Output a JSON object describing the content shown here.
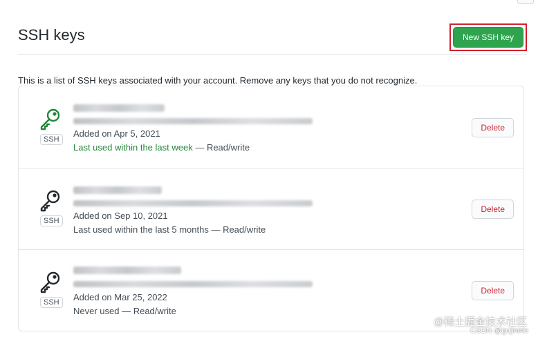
{
  "header": {
    "title": "SSH keys",
    "new_key_label": "New SSH key"
  },
  "intro": "This is a list of SSH keys associated with your account. Remove any keys that you do not recognize.",
  "keys": [
    {
      "badge": "SSH",
      "added": "Added on Apr 5, 2021",
      "last_used": "Last used within the last week",
      "access": " — Read/write",
      "recent": true,
      "delete_label": "Delete",
      "icon": "key-icon",
      "icon_color": "#22863a"
    },
    {
      "badge": "SSH",
      "added": "Added on Sep 10, 2021",
      "last_used": "Last used within the last 5 months",
      "access": " — Read/write",
      "recent": false,
      "delete_label": "Delete",
      "icon": "key-icon",
      "icon_color": "#24292e"
    },
    {
      "badge": "SSH",
      "added": "Added on Mar 25, 2022",
      "last_used": "Never used",
      "access": " — Read/write",
      "recent": false,
      "delete_label": "Delete",
      "icon": "key-icon",
      "icon_color": "#24292e"
    }
  ],
  "watermark": {
    "main": "@稀土掘金技术社区",
    "sub": "CSDN @gujinme"
  },
  "colors": {
    "primary_button": "#2ea44f",
    "danger_text": "#cb2431",
    "recent_text": "#22863a",
    "highlight_border": "#d0202d"
  }
}
